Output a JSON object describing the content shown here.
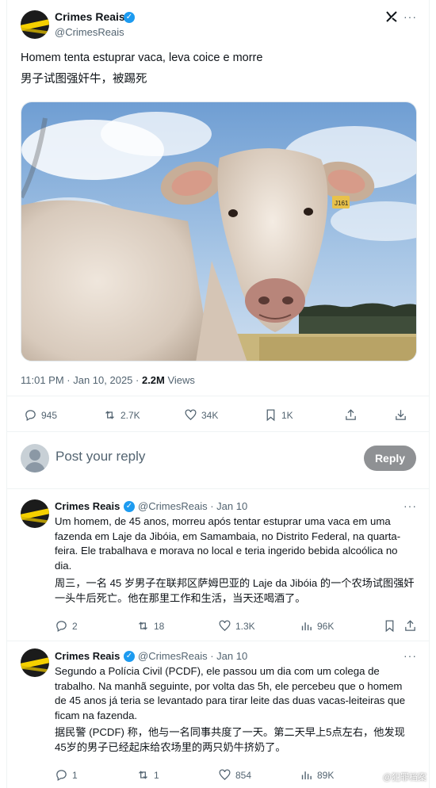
{
  "main_tweet": {
    "author_name": "Crimes Reais",
    "author_handle": "@CrimesReais",
    "verified_mark": "✓",
    "grok_label": "✕̸",
    "more_label": "···",
    "text_pt": "Homem tenta estuprar vaca, leva coice e morre",
    "text_zh": "男子试图强奸牛，被踢死",
    "ear_tag": "J161",
    "timestamp": "11:01 PM · Jan 10, 2025 · ",
    "views_count": "2.2M",
    "views_label": " Views",
    "actions": {
      "replies": "945",
      "reposts": "2.7K",
      "likes": "34K",
      "bookmarks": "1K"
    }
  },
  "reply_box": {
    "placeholder": "Post your reply",
    "button_label": "Reply"
  },
  "replies": [
    {
      "author_name": "Crimes Reais",
      "author_handle": "@CrimesReais · Jan 10",
      "lines_pt": [
        "Um homem, de 45 anos, morreu após tentar estuprar uma vaca em uma",
        "fazenda em Laje da Jibóia, em Samambaia, no Distrito Federal, na quarta-",
        "feira. Ele trabalhava e morava no local e teria ingerido bebida alcoólica no",
        "dia."
      ],
      "lines_zh": [
        "周三，一名 45 岁男子在联邦区萨姆巴亚的 Laje da Jibóia 的一个农场试图强奸",
        "一头牛后死亡。他在那里工作和生活，当天还喝酒了。"
      ],
      "actions": {
        "replies": "2",
        "reposts": "18",
        "likes": "1.3K",
        "views": "96K"
      }
    },
    {
      "author_name": "Crimes Reais",
      "author_handle": "@CrimesReais · Jan 10",
      "lines_pt": [
        "Segundo a Polícia Civil (PCDF), ele passou um dia com um colega de",
        "trabalho. Na manhã seguinte, por volta das 5h, ele percebeu que o homem",
        "de 45 anos já teria se levantado para tirar leite das duas vacas-leiteiras que",
        "ficam na fazenda."
      ],
      "lines_zh": [
        "据民警 (PCDF) 称，他与一名同事共度了一天。第二天早上5点左右，他发现",
        "45岁的男子已经起床给农场里的两只奶牛挤奶了。"
      ],
      "actions": {
        "replies": "1",
        "reposts": "1",
        "likes": "854",
        "views": "89K"
      }
    }
  ],
  "watermark": "@犯罪档案",
  "colors": {
    "text": "#0f1419",
    "secondary": "#536471",
    "verified": "#1d9bf0",
    "reply_button": "#8f9194",
    "divider": "#eff3f4"
  }
}
